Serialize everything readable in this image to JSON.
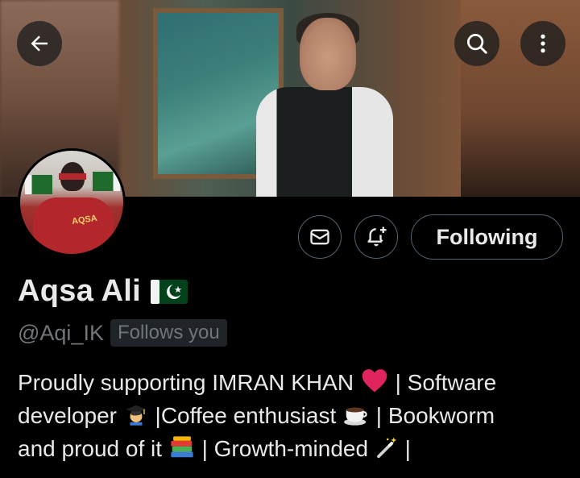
{
  "banner": {
    "back_icon": "arrow-left-icon",
    "search_icon": "search-icon",
    "more_icon": "more-vertical-icon"
  },
  "avatar": {
    "overlay_text": "AQSA"
  },
  "actions": {
    "message_icon": "envelope-icon",
    "notify_icon": "bell-plus-icon",
    "following_label": "Following"
  },
  "profile": {
    "display_name": "Aqsa Ali",
    "flag_icon": "pakistan-flag-icon",
    "handle": "@Aqi_IK",
    "follows_you": "Follows you"
  },
  "bio": {
    "line1_a": "Proudly supporting IMRAN KHAN",
    "line1_b": "| Software",
    "line2_a": "developer",
    "line2_b": "|Coffee enthusiast",
    "line2_c": "| Bookworm",
    "line3_a": "and proud of it",
    "line3_b": "| Growth-minded",
    "line3_c": "|"
  },
  "colors": {
    "background": "#000000",
    "text_primary": "#e7e9ea",
    "text_secondary": "#71767b",
    "border": "#536471",
    "badge_bg": "#202327"
  }
}
